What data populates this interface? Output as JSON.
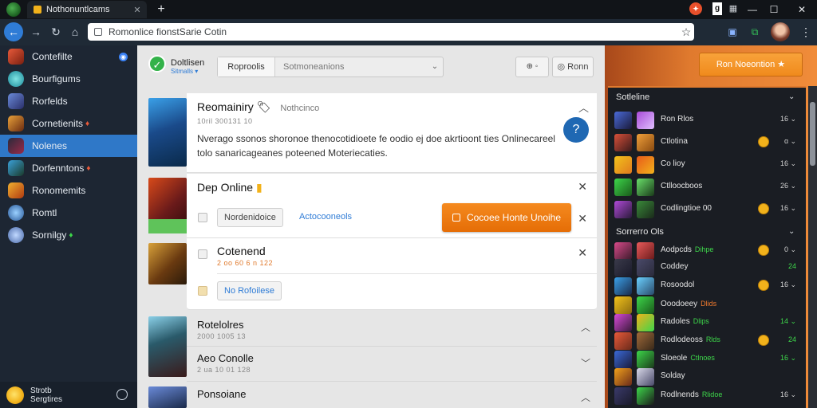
{
  "browser": {
    "tab_title": "Nothonuntlcams",
    "tab_close": "✕",
    "new_tab": "+",
    "url": "Romonlice fionstSarie Cotin",
    "window_controls": [
      "—",
      "☐",
      "✕"
    ],
    "ext_red": "✦",
    "ext_white": "g",
    "ext_gray": "▦",
    "toolbar_exts": [
      "▣",
      "⧉"
    ]
  },
  "sidebar": {
    "items": [
      {
        "label": "Contefilte",
        "badge": "◉"
      },
      {
        "label": "Bourfigums"
      },
      {
        "label": "Rorfelds"
      },
      {
        "label": "Cornetienits",
        "mark": "♦"
      },
      {
        "label": "Nolenes",
        "active": true
      },
      {
        "label": "Dorfenntons",
        "mark": "♦"
      },
      {
        "label": "Ronomemits"
      },
      {
        "label": "Romtl"
      },
      {
        "label": "Sornilgy",
        "mark": "♦"
      }
    ],
    "footer_line1": "Strotb",
    "footer_line2": "Sergtires"
  },
  "main": {
    "header_title": "Doltlisen",
    "header_sub": "Sitmalls ▾",
    "seg_a": "Roproolis",
    "seg_b": "Sotmoneanions",
    "seg_caret": "⌄",
    "hdr_icons": "⊕  ◦",
    "hdr_btn": "◎  Ronn",
    "card1": {
      "title": "Reomainiry",
      "title_emoji": "🏷",
      "tag": "Nothcinco",
      "meta": "10ril 300131 10",
      "desc": "Nverago ssonos shoronoe thenocotidioete fe oodio ej doe akrtioont ties Onlinecareel tolo sanaricageanes poteened Moteriecaties."
    },
    "card2": {
      "title": "Dep Online",
      "chip": "Nordenidoice",
      "link": "Actocooneols",
      "cta": "Cocoee Honte Unoihe"
    },
    "card3": {
      "title": "Cotenend",
      "meta": "2 oo 60 6 n 122",
      "chip": "No Rofoilese"
    },
    "lower": [
      {
        "title": "Rotelolres",
        "meta": "2000 1005 13"
      },
      {
        "title": "Aeo Conolle",
        "meta": "2 ua 10 01 128"
      },
      {
        "title": "Ponsoiane",
        "meta": ""
      }
    ]
  },
  "right": {
    "orange_button": "Ron Noeontion ★",
    "section1_title": "Sotleline",
    "section1_rows": [
      {
        "name": "Ron Rlos",
        "val": "16 ⌄"
      },
      {
        "name": "Ctlotina",
        "val": "ɑ ⌄"
      },
      {
        "name": "Co lioy",
        "val": "16 ⌄"
      },
      {
        "name": "Ctlloocboos",
        "val": "26 ⌄"
      },
      {
        "name": "Codlingtioe 00",
        "val": "16 ⌄"
      }
    ],
    "section2_title": "Sorrerro Ols",
    "section2_rows": [
      {
        "name": "Aodpcds",
        "green": "Dihpe",
        "val": "0 ⌄"
      },
      {
        "name": "Coddey",
        "green": "",
        "val": "24"
      },
      {
        "name": "Rosoodol",
        "green": "",
        "val": "16 ⌄"
      },
      {
        "name": "Ooodoeey",
        "green": "Dlids",
        "val": ""
      },
      {
        "name": "Radoles",
        "green": "Dlips",
        "val": "14 ⌄"
      },
      {
        "name": "Rodlodeoss",
        "green": "Rlds",
        "val": "24"
      },
      {
        "name": "Sloeole",
        "green": "Ctlnoes",
        "val": "16 ⌄"
      },
      {
        "name": "Solday",
        "green": "",
        "val": ""
      },
      {
        "name": "Rodlnends",
        "green": "Rlidoe",
        "val": "16 ⌄"
      }
    ]
  }
}
